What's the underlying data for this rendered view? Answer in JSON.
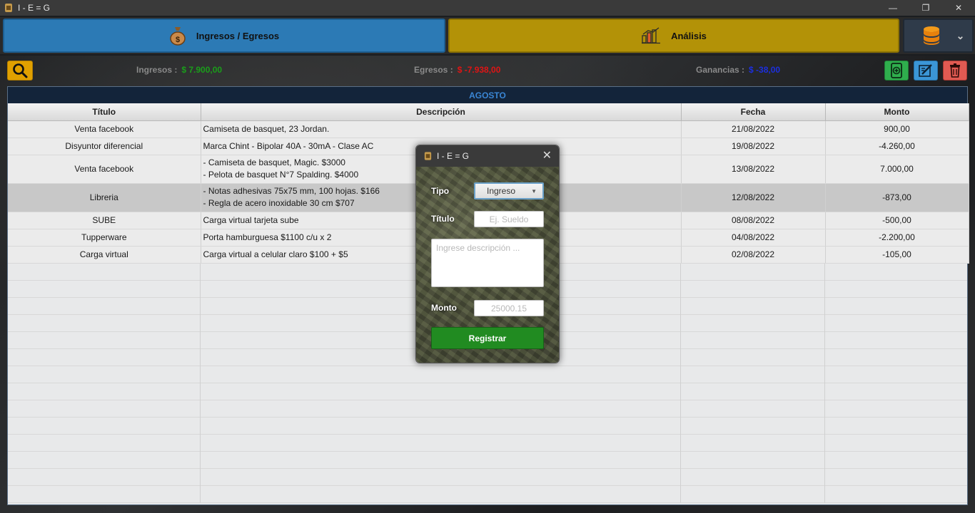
{
  "window": {
    "title": "I - E = G",
    "minimize_glyph": "—",
    "restore_glyph": "❐",
    "close_glyph": "✕"
  },
  "nav": {
    "ingresos_egresos_label": "Ingresos / Egresos",
    "analisis_label": "Análisis",
    "dropdown_glyph": "⌄"
  },
  "summary": {
    "ingresos_label": "Ingresos :",
    "ingresos_value": "$ 7.900,00",
    "egresos_label": "Egresos :",
    "egresos_value": "$ -7.938,00",
    "ganancias_label": "Ganancias :",
    "ganancias_value": "$ -38,00",
    "colors": {
      "ingresos": "#1a9e1a",
      "egresos": "#e01414",
      "ganancias": "#1c2fe0"
    }
  },
  "table": {
    "month": "AGOSTO",
    "headers": {
      "titulo": "Título",
      "descripcion": "Descripción",
      "fecha": "Fecha",
      "monto": "Monto"
    },
    "rows": [
      {
        "titulo": "Venta facebook",
        "descripcion": [
          "Camiseta de basquet, 23 Jordan."
        ],
        "fecha": "21/08/2022",
        "monto": "900,00"
      },
      {
        "titulo": "Disyuntor diferencial",
        "descripcion": [
          "Marca Chint - Bipolar 40A - 30mA - Clase AC"
        ],
        "fecha": "19/08/2022",
        "monto": "-4.260,00"
      },
      {
        "titulo": "Venta facebook",
        "descripcion": [
          "- Camiseta de basquet, Magic. $3000",
          "- Pelota de basquet N°7 Spalding. $4000"
        ],
        "fecha": "13/08/2022",
        "monto": "7.000,00"
      },
      {
        "titulo": "Libreria",
        "descripcion": [
          "- Notas adhesivas 75x75 mm, 100 hojas. $166",
          "- Regla de acero inoxidable 30 cm $707"
        ],
        "fecha": "12/08/2022",
        "monto": "-873,00"
      },
      {
        "titulo": "SUBE",
        "descripcion": [
          "Carga virtual tarjeta sube"
        ],
        "fecha": "08/08/2022",
        "monto": "-500,00"
      },
      {
        "titulo": "Tupperware",
        "descripcion": [
          "Porta hamburguesa $1100 c/u x 2"
        ],
        "fecha": "04/08/2022",
        "monto": "-2.200,00"
      },
      {
        "titulo": "Carga virtual",
        "descripcion": [
          "Carga virtual a celular claro $100 + $5"
        ],
        "fecha": "02/08/2022",
        "monto": "-105,00"
      }
    ]
  },
  "dialog": {
    "title": "I - E = G",
    "close_glyph": "✕",
    "tipo_label": "Tipo",
    "tipo_value": "Ingreso",
    "titulo_label": "Título",
    "titulo_placeholder": "Ej. Sueldo",
    "descripcion_placeholder": "Ingrese descripción ...",
    "monto_label": "Monto",
    "monto_placeholder": "25000.15",
    "submit_label": "Registrar"
  }
}
